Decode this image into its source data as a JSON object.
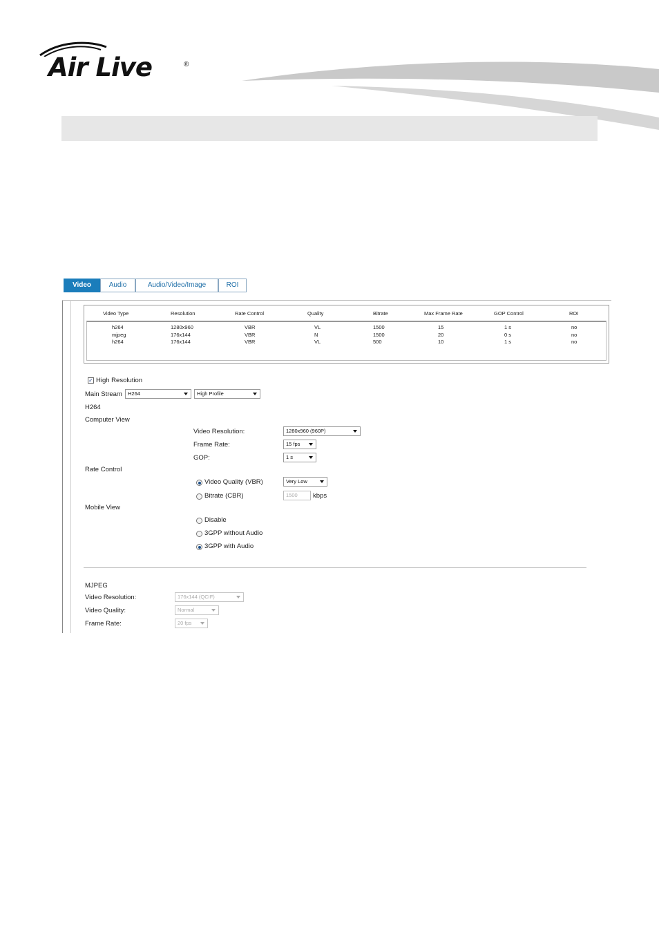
{
  "header": {
    "logo_text": "Air Live",
    "logo_reg": "®"
  },
  "tabs": [
    {
      "label": "Video",
      "active": true
    },
    {
      "label": "Audio",
      "active": false
    },
    {
      "label": "Audio/Video/Image",
      "active": false
    },
    {
      "label": "ROI",
      "active": false
    }
  ],
  "stream_table": {
    "columns": [
      "Video Type",
      "Resolution",
      "Rate Control",
      "Quality",
      "Bitrate",
      "Max Frame Rate",
      "GOP Control",
      "ROI"
    ],
    "rows": [
      [
        "h264",
        "1280x960",
        "VBR",
        "VL",
        "1500",
        "15",
        "1 s",
        "no"
      ],
      [
        "mjpeg",
        "176x144",
        "VBR",
        "N",
        "1500",
        "20",
        "0 s",
        "no"
      ],
      [
        "h264",
        "176x144",
        "VBR",
        "VL",
        "500",
        "10",
        "1 s",
        "no"
      ]
    ]
  },
  "high_resolution": {
    "label": "High Resolution",
    "checked": true
  },
  "main_stream": {
    "label": "Main Stream",
    "codec": "H264",
    "profile": "High Profile"
  },
  "h264": {
    "heading": "H264",
    "computer_view": {
      "heading": "Computer View",
      "video_resolution_label": "Video Resolution:",
      "video_resolution_value": "1280x960 (960P)",
      "frame_rate_label": "Frame Rate:",
      "frame_rate_value": "15 fps",
      "gop_label": "GOP:",
      "gop_value": "1 s"
    },
    "rate_control": {
      "heading": "Rate Control",
      "vbr_label": "Video Quality (VBR)",
      "vbr_value": "Very Low",
      "cbr_label": "Bitrate (CBR)",
      "cbr_value": "1500",
      "cbr_unit": "kbps"
    },
    "mobile_view": {
      "heading": "Mobile View",
      "options": [
        "Disable",
        "3GPP without Audio",
        "3GPP with Audio"
      ]
    }
  },
  "mjpeg": {
    "heading": "MJPEG",
    "video_resolution_label": "Video Resolution:",
    "video_resolution_value": "176x144 (QCIF)",
    "video_quality_label": "Video Quality:",
    "video_quality_value": "Normal",
    "frame_rate_label": "Frame Rate:",
    "frame_rate_value": "20 fps"
  }
}
